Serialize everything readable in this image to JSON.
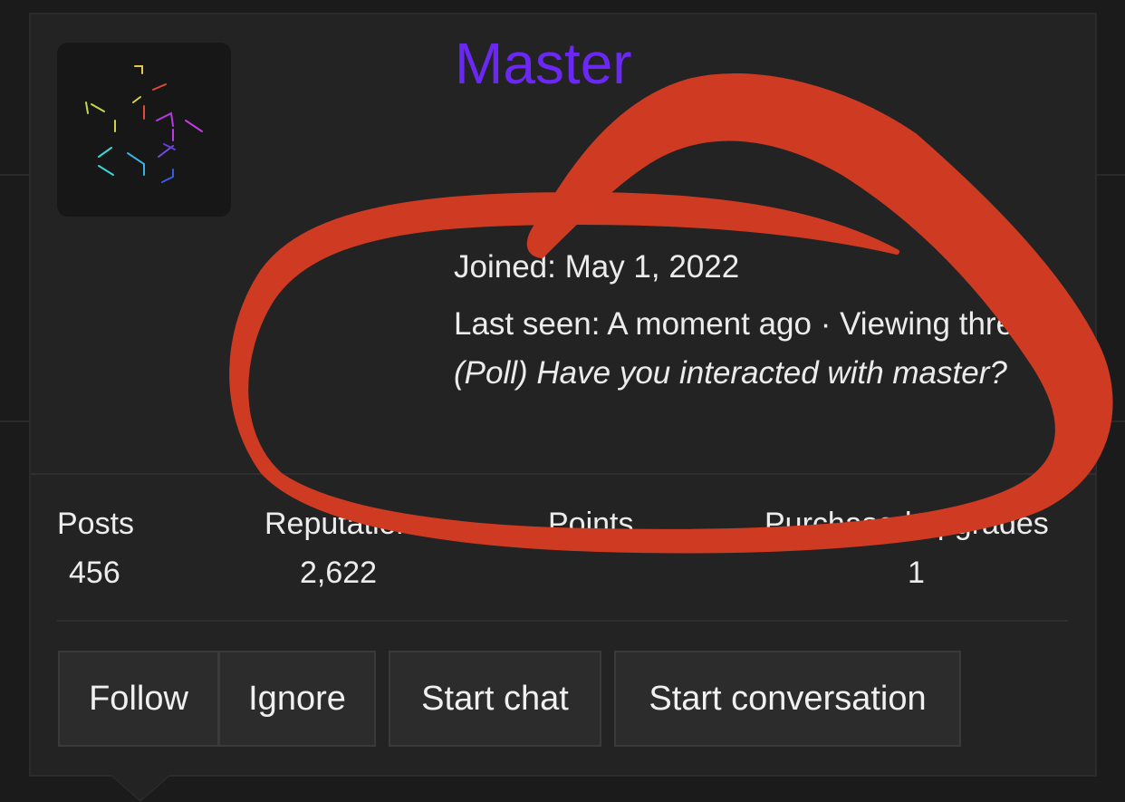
{
  "profile": {
    "username": "Master",
    "joined_text": "Joined: May 1, 2022",
    "last_seen_prefix": "Last seen: A moment ago · Viewing thread ",
    "last_seen_thread": "(Poll) Have you interacted with master?",
    "username_color": "#6b27f5"
  },
  "stats": {
    "posts_label": "Posts",
    "posts_value": "456",
    "reputation_label": "Reputation",
    "reputation_value": "2,622",
    "points_label": "Points",
    "upgrades_label": "Purchased upgrades",
    "upgrades_value": "1"
  },
  "actions": {
    "follow_label": "Follow",
    "ignore_label": "Ignore",
    "start_chat_label": "Start chat",
    "start_conversation_label": "Start conversation"
  },
  "annotation": {
    "color": "#cf3a22",
    "shape": "hand-drawn circle"
  }
}
